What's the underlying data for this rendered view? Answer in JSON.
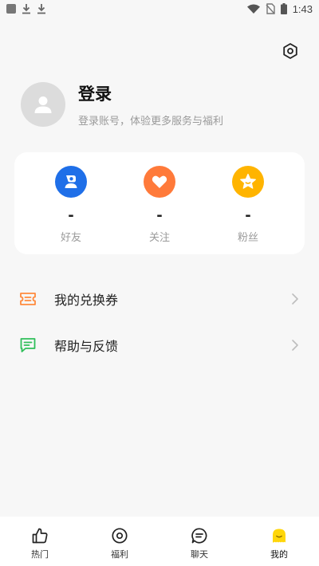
{
  "status_bar": {
    "time": "1:43",
    "icons": [
      "app-icon",
      "download-icon",
      "download-icon",
      "wifi-icon",
      "no-sim-icon",
      "battery-icon"
    ]
  },
  "header": {
    "settings_icon": "settings-hexagon-icon"
  },
  "profile": {
    "title": "登录",
    "subtitle": "登录账号，体验更多服务与福利",
    "avatar_icon": "person-icon"
  },
  "stats": [
    {
      "label": "好友",
      "value": "-",
      "icon": "friend-icon",
      "color": "#1f6fe8"
    },
    {
      "label": "关注",
      "value": "-",
      "icon": "heart-icon",
      "color": "#ff7a3a"
    },
    {
      "label": "粉丝",
      "value": "-",
      "icon": "star-icon",
      "color": "#ffb400"
    }
  ],
  "menu": [
    {
      "label": "我的兑换券",
      "icon": "ticket-icon",
      "color": "#ff8a3d"
    },
    {
      "label": "帮助与反馈",
      "icon": "feedback-icon",
      "color": "#2fbf5a"
    }
  ],
  "bottom_nav": [
    {
      "label": "热门",
      "icon": "thumbs-up-icon",
      "active": false
    },
    {
      "label": "福利",
      "icon": "disc-icon",
      "active": false
    },
    {
      "label": "聊天",
      "icon": "chat-icon",
      "active": false
    },
    {
      "label": "我的",
      "icon": "face-icon",
      "active": true
    }
  ],
  "colors": {
    "background": "#f7f7f7",
    "card": "#ffffff",
    "active_nav": "#ffd60a"
  }
}
